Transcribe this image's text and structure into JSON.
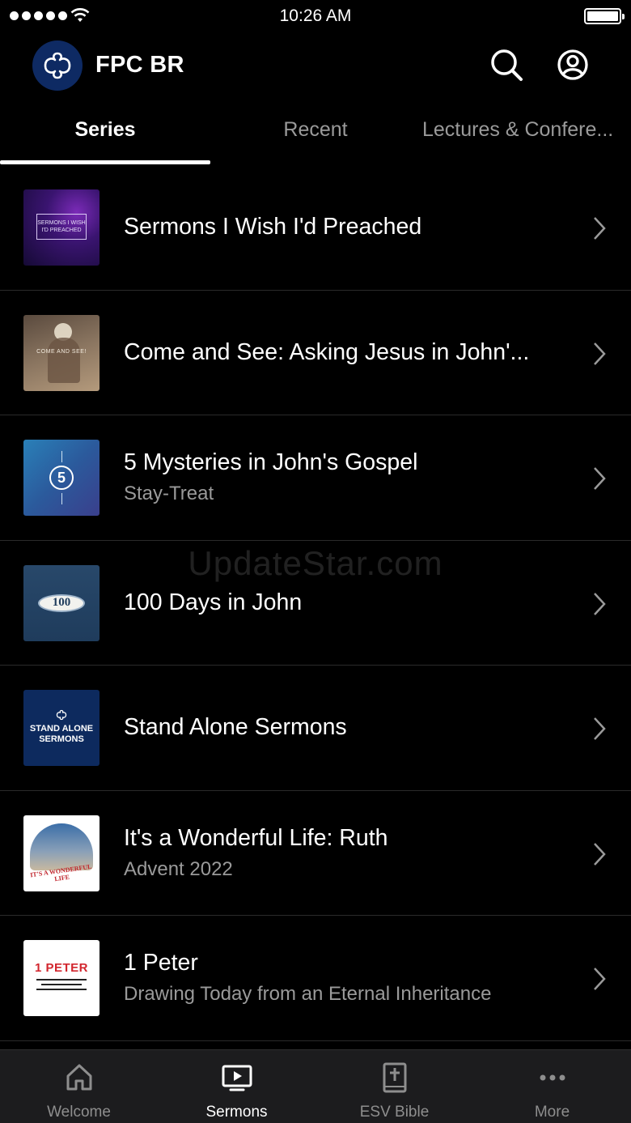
{
  "status_bar": {
    "time": "10:26 AM"
  },
  "header": {
    "title": "FPC BR"
  },
  "tabs": [
    {
      "label": "Series",
      "active": true
    },
    {
      "label": "Recent",
      "active": false
    },
    {
      "label": "Lectures & Confere..."
    }
  ],
  "series": [
    {
      "title": "Sermons I Wish I'd Preached",
      "subtitle": "",
      "thumb_text": "SERMONS I WISH I'D PREACHED"
    },
    {
      "title": "Come and See: Asking Jesus in John'...",
      "subtitle": "",
      "thumb_text": "COME AND SEE!"
    },
    {
      "title": "5 Mysteries in John's Gospel",
      "subtitle": "Stay-Treat",
      "thumb_text": "5"
    },
    {
      "title": "100 Days in John",
      "subtitle": "",
      "thumb_text": "100"
    },
    {
      "title": "Stand Alone Sermons",
      "subtitle": "",
      "thumb_text": "STAND ALONE SERMONS"
    },
    {
      "title": "It's a Wonderful Life: Ruth",
      "subtitle": "Advent 2022",
      "thumb_text": "IT'S A WONDERFUL LIFE"
    },
    {
      "title": "1 Peter",
      "subtitle": "Drawing Today from an Eternal Inheritance",
      "thumb_text": "1 PETER"
    }
  ],
  "watermark": "UpdateStar.com",
  "bottom_nav": [
    {
      "label": "Welcome",
      "icon": "home-icon"
    },
    {
      "label": "Sermons",
      "icon": "tv-play-icon",
      "active": true
    },
    {
      "label": "ESV Bible",
      "icon": "bible-icon"
    },
    {
      "label": "More",
      "icon": "more-icon"
    }
  ],
  "colors": {
    "logo_bg": "#0e2a63",
    "inactive": "#9a9a9a",
    "nav_bg": "#1c1c1e"
  }
}
